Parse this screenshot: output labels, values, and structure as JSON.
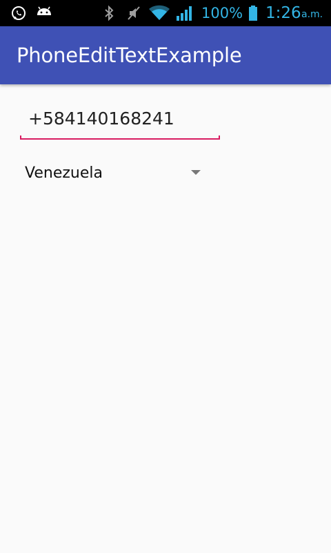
{
  "status_bar": {
    "battery_percent": "100%",
    "time": "1:26",
    "ampm": "a.m.",
    "icons": [
      "whatsapp-icon",
      "android-icon",
      "bluetooth-icon",
      "mute-icon",
      "wifi-icon",
      "signal-icon",
      "battery-icon"
    ],
    "accent_color": "#33b5e5"
  },
  "app_bar": {
    "title": "PhoneEditTextExample",
    "color": "#3f51b5"
  },
  "phone_input": {
    "value": "+584140168241",
    "underline_color": "#d81b60"
  },
  "country_spinner": {
    "selected": "Venezuela"
  }
}
